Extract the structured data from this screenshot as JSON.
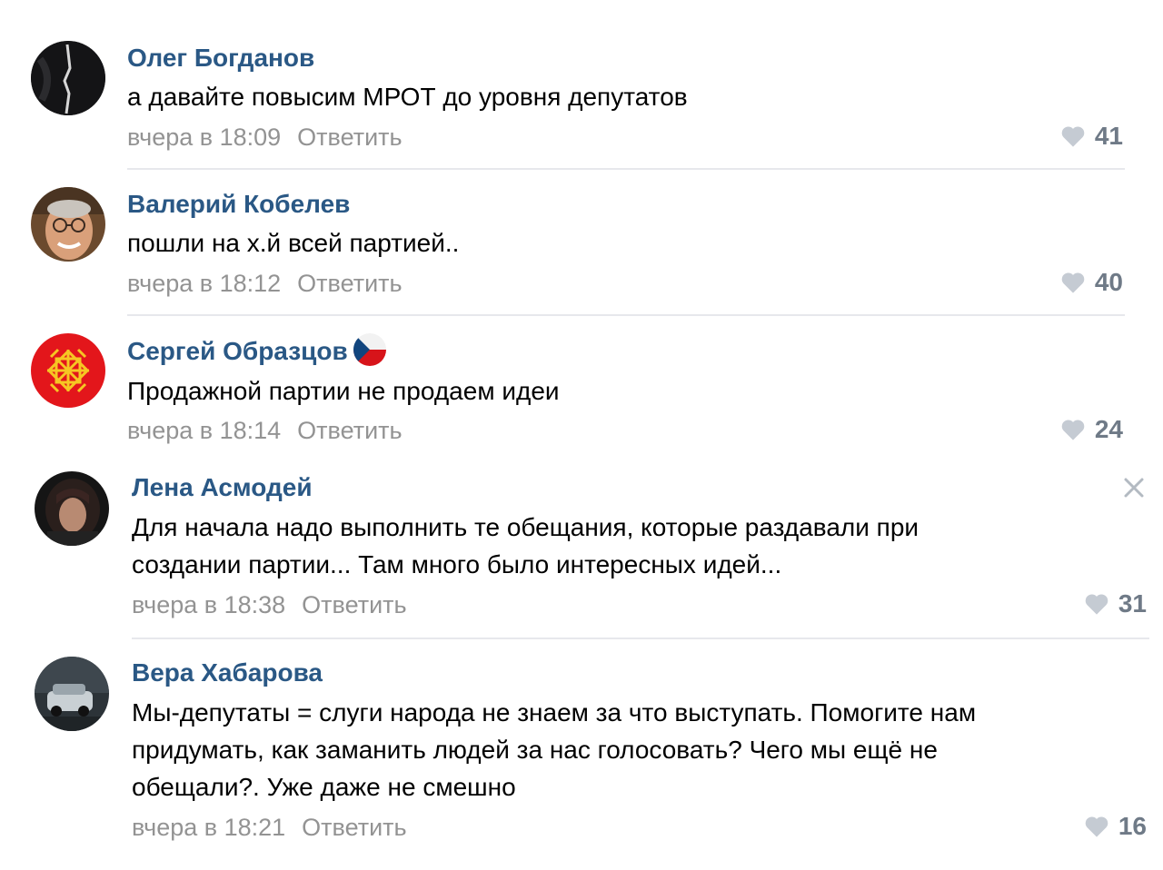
{
  "comments": [
    {
      "author": "Олег Богданов",
      "text_lines": [
        "а давайте повысим МРОТ до уровня депутатов"
      ],
      "date": "вчера в 18:09",
      "reply": "Ответить",
      "likes": "41",
      "avatar_icon": "dark-abstract-avatar"
    },
    {
      "author": "Валерий Кобелев",
      "text_lines": [
        "пошли на х.й всей партией.."
      ],
      "date": "вчера в 18:12",
      "reply": "Ответить",
      "likes": "40",
      "avatar_icon": "man-with-glasses-avatar"
    },
    {
      "author": "Сергей Образцов",
      "text_lines": [
        "Продажной партии не продаем идеи"
      ],
      "date": "вчера в 18:14",
      "reply": "Ответить",
      "likes": "24",
      "avatar_icon": "red-ornament-avatar",
      "badge_icon": "czech-flag-icon"
    },
    {
      "author": "Лена Асмодей",
      "text_lines": [
        "Для начала надо выполнить те обещания, которые раздавали при",
        "создании партии... Там много было интересных идей..."
      ],
      "date": "вчера в 18:38",
      "reply": "Ответить",
      "likes": "31",
      "avatar_icon": "woman-portrait-avatar"
    },
    {
      "author": "Вера Хабарова",
      "text_lines": [
        "Мы-депутаты = слуги народа не знаем за что выступать. Помогите нам",
        "придумать, как заманить людей за нас голосовать? Чего мы ещё не",
        "обещали?. Уже даже не смешно"
      ],
      "date": "вчера в 18:21",
      "reply": "Ответить",
      "likes": "16",
      "avatar_icon": "car-photo-avatar"
    }
  ],
  "colors": {
    "author": "#2a5885",
    "meta": "#939393",
    "like": "#6f7a87",
    "divider": "#e7e8ec"
  }
}
